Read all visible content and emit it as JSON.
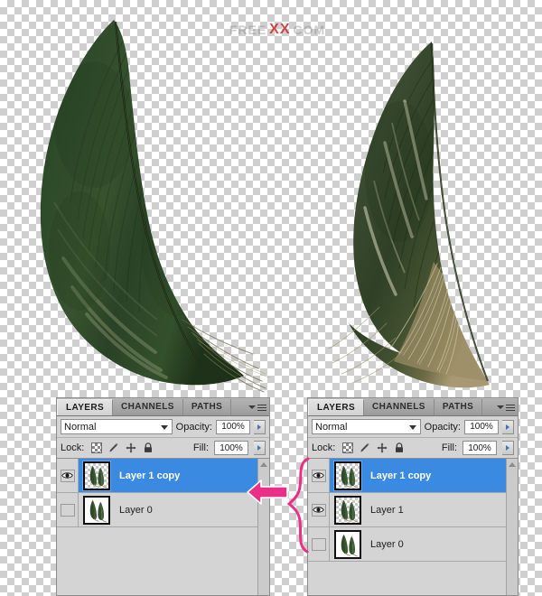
{
  "canvas": {
    "background": "transparent-checkerboard",
    "watermark": {
      "left_text": "FREE",
      "mid_text": "XX",
      "right_text": "COM",
      "accent_color": "#cf2828"
    }
  },
  "artwork": {
    "feather_left": {
      "name": "green-feather-large",
      "body_color": "#2c4229",
      "shaft_color": "#1b2a18",
      "tip_color": "#7d7a52"
    },
    "feather_right": {
      "name": "green-feather-small",
      "body_color": "#36452f",
      "shaft_color": "#20301c",
      "down_color": "#a79a72"
    }
  },
  "panels": [
    {
      "id": "panel-left",
      "tabs": [
        {
          "label": "LAYERS",
          "active": true
        },
        {
          "label": "CHANNELS",
          "active": false
        },
        {
          "label": "PATHS",
          "active": false
        }
      ],
      "menu_icon": "panel-menu-icon",
      "blend": {
        "mode": "Normal",
        "opacity_label": "Opacity:",
        "opacity_value": "100%"
      },
      "lock": {
        "label": "Lock:",
        "icons": [
          "lock-transparency-icon",
          "lock-image-icon",
          "lock-position-icon",
          "lock-all-icon"
        ],
        "fill_label": "Fill:",
        "fill_value": "100%"
      },
      "layers": [
        {
          "name": "Layer 1 copy",
          "visible": true,
          "selected": true,
          "thumb": "transparent"
        },
        {
          "name": "Layer 0",
          "visible": false,
          "selected": false,
          "thumb": "white"
        }
      ]
    },
    {
      "id": "panel-right",
      "tabs": [
        {
          "label": "LAYERS",
          "active": true
        },
        {
          "label": "CHANNELS",
          "active": false
        },
        {
          "label": "PATHS",
          "active": false
        }
      ],
      "menu_icon": "panel-menu-icon",
      "blend": {
        "mode": "Normal",
        "opacity_label": "Opacity:",
        "opacity_value": "100%"
      },
      "lock": {
        "label": "Lock:",
        "icons": [
          "lock-transparency-icon",
          "lock-image-icon",
          "lock-position-icon",
          "lock-all-icon"
        ],
        "fill_label": "Fill:",
        "fill_value": "100%"
      },
      "layers": [
        {
          "name": "Layer 1 copy",
          "visible": true,
          "selected": true,
          "thumb": "transparent"
        },
        {
          "name": "Layer 1",
          "visible": true,
          "selected": false,
          "thumb": "transparent"
        },
        {
          "name": "Layer 0",
          "visible": false,
          "selected": false,
          "thumb": "white"
        }
      ]
    }
  ],
  "annotations": {
    "arrow": {
      "name": "pink-left-arrow",
      "color": "#ec2f86",
      "direction": "left"
    },
    "brace": {
      "name": "pink-curly-brace",
      "color": "#ec2f86"
    }
  },
  "colors": {
    "selection_blue": "#3a8ae2",
    "panel_gray": "#d4d4d4",
    "annotation_pink": "#ec2f86"
  }
}
